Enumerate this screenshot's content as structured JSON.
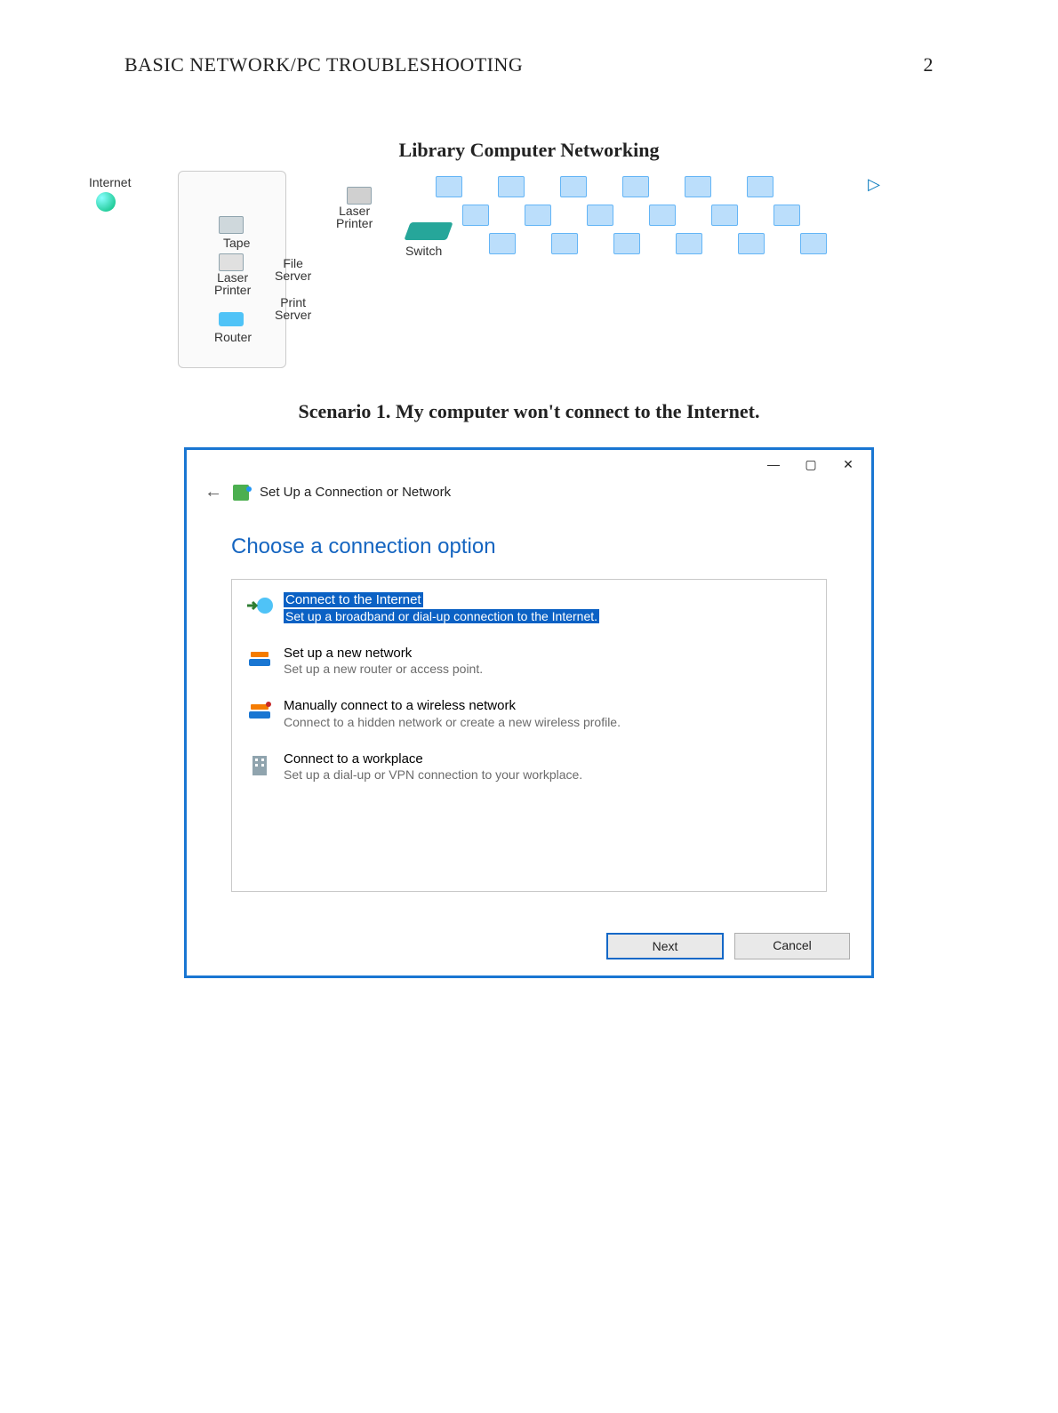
{
  "header": {
    "running_head": "BASIC NETWORK/PC TROUBLESHOOTING",
    "page_number": "2"
  },
  "document": {
    "title": "Library Computer Networking",
    "scenario_heading": "Scenario 1. My computer won't connect to the Internet."
  },
  "diagram": {
    "labels": {
      "internet": "Internet",
      "tape": "Tape",
      "laser_printer_left": "Laser\nPrinter",
      "file_server": "File\nServer",
      "print_server": "Print\nServer",
      "router": "Router",
      "laser_printer_mid": "Laser\nPrinter",
      "switch": "Switch"
    }
  },
  "dialog": {
    "window_controls": {
      "minimize": "—",
      "maximize": "▢",
      "close": "✕"
    },
    "breadcrumb_title": "Set Up a Connection or Network",
    "heading": "Choose a connection option",
    "options": [
      {
        "title": "Connect to the Internet",
        "desc": "Set up a broadband or dial-up connection to the Internet.",
        "selected": true,
        "icon": "globe-arrow"
      },
      {
        "title": "Set up a new network",
        "desc": "Set up a new router or access point.",
        "selected": false,
        "icon": "router"
      },
      {
        "title": "Manually connect to a wireless network",
        "desc": "Connect to a hidden network or create a new wireless profile.",
        "selected": false,
        "icon": "router"
      },
      {
        "title": "Connect to a workplace",
        "desc": "Set up a dial-up or VPN connection to your workplace.",
        "selected": false,
        "icon": "building"
      }
    ],
    "buttons": {
      "next": "Next",
      "cancel": "Cancel"
    }
  }
}
